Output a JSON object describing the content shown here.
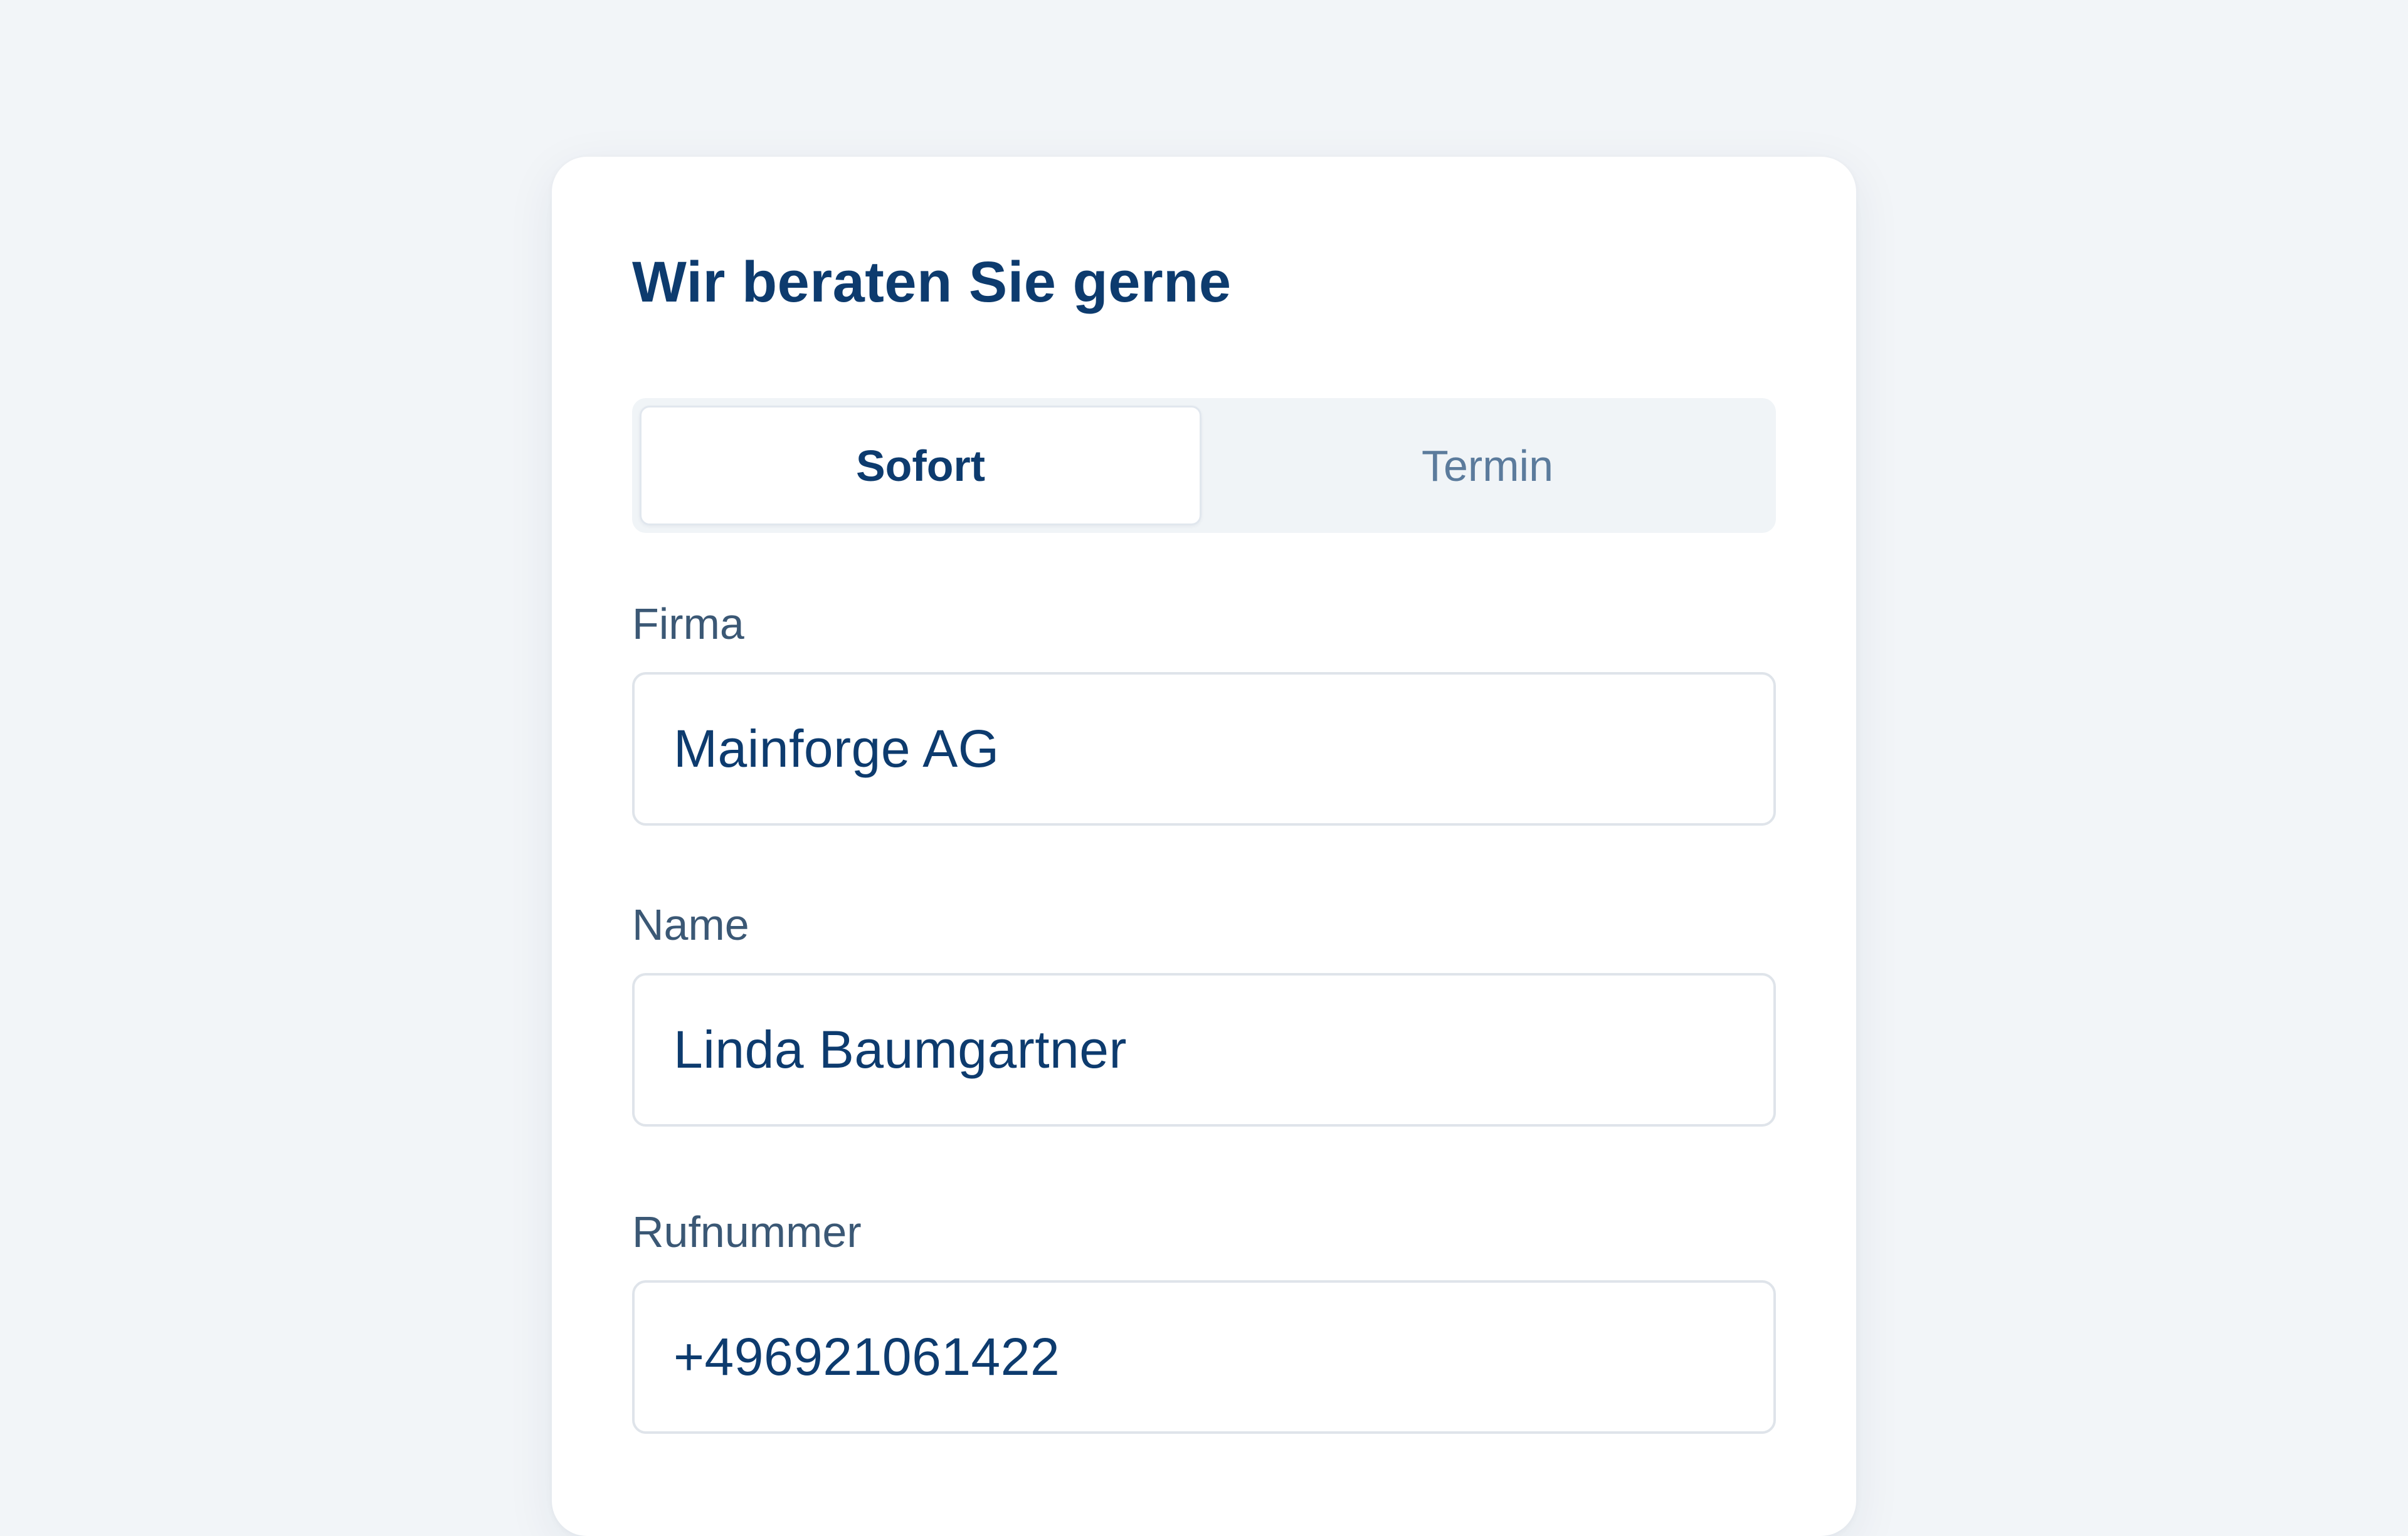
{
  "form": {
    "title": "Wir beraten Sie gerne",
    "tabs": [
      {
        "label": "Sofort",
        "active": true
      },
      {
        "label": "Termin",
        "active": false
      }
    ],
    "fields": {
      "company": {
        "label": "Firma",
        "value": "Mainforge AG"
      },
      "name": {
        "label": "Name",
        "value": "Linda Baumgartner"
      },
      "phone": {
        "label": "Rufnummer",
        "value": "+496921061422"
      }
    }
  },
  "colors": {
    "background": "#f2f5f8",
    "card": "#ffffff",
    "primary_text": "#0d3b6e",
    "label_text": "#3b5875",
    "inactive_tab_text": "#5b7b9c",
    "input_border": "#dfe4ea"
  }
}
